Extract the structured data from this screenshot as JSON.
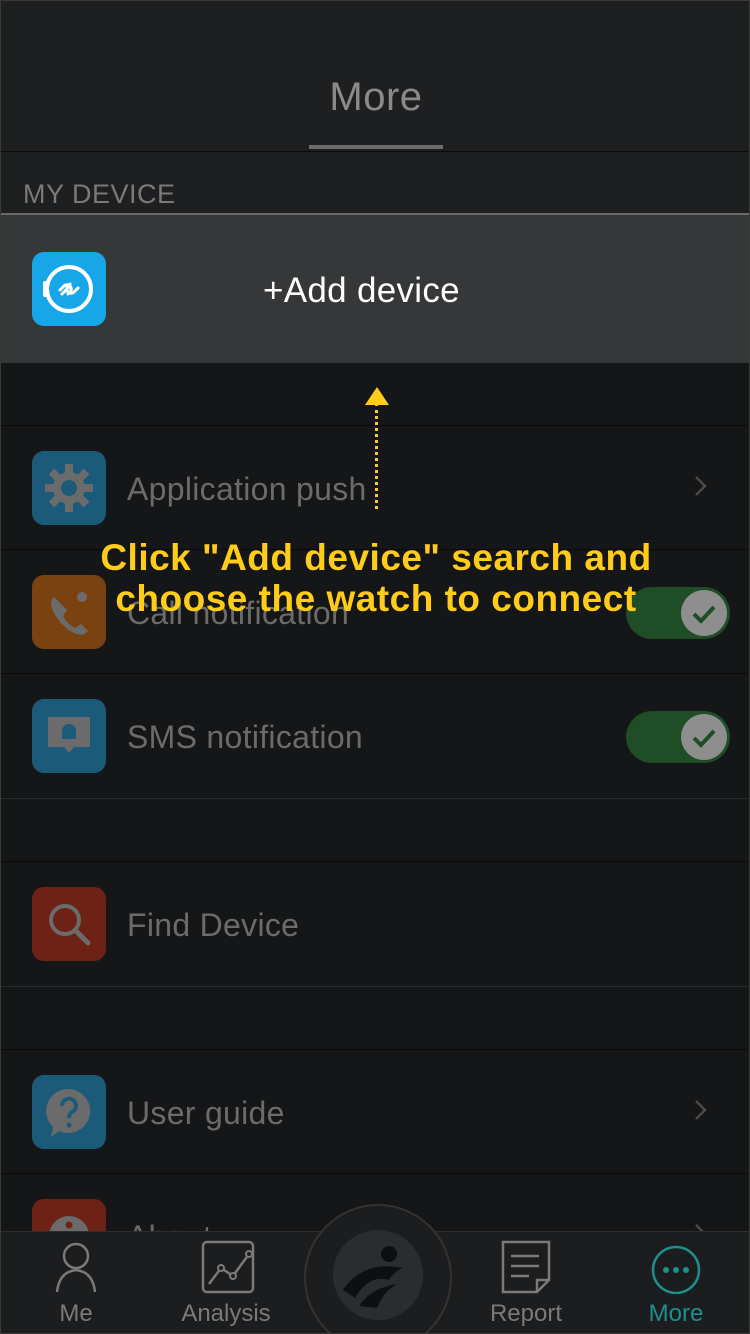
{
  "header": {
    "title": "More"
  },
  "section": {
    "label": "MY DEVICE"
  },
  "add_device": {
    "label": "+Add device"
  },
  "rows": [
    {
      "label": "Application push",
      "control": "chevron"
    },
    {
      "label": "Call notification",
      "control": "toggle",
      "checked": true
    },
    {
      "label": "SMS notification",
      "control": "toggle",
      "checked": true
    },
    {
      "label": "Find Device",
      "control": "none"
    },
    {
      "label": "User guide",
      "control": "chevron"
    },
    {
      "label": "About",
      "control": "chevron"
    }
  ],
  "annotation": {
    "line1": "Click \"Add device\" search and",
    "line2": "choose  the watch to connect"
  },
  "tabbar": {
    "tabs": [
      {
        "label": "Me"
      },
      {
        "label": "Analysis"
      },
      {
        "label": "Report"
      },
      {
        "label": "More"
      }
    ]
  },
  "colors": {
    "accent_annotation": "#ffcc1a",
    "active_tab": "#1e8f8c",
    "toggle_on": "#1f4d25",
    "add_device_icon": "#17a6e8"
  }
}
